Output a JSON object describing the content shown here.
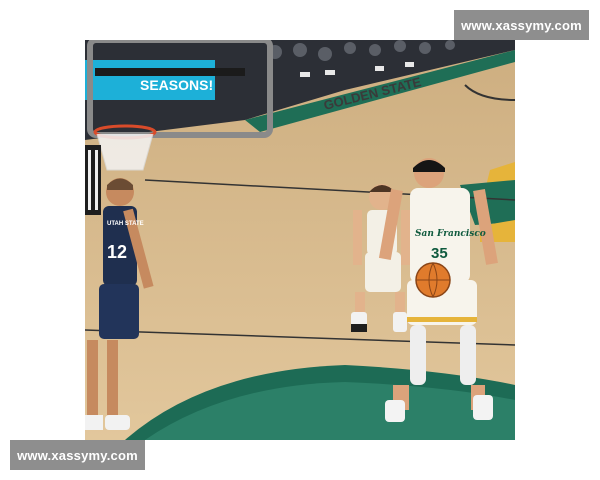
{
  "watermarks": {
    "top_right": "www.xassymy.com",
    "bottom_left": "www.xassymy.com"
  },
  "photo": {
    "banner_text": "SEASONS!",
    "court_text": "GOLDEN STATE",
    "shooter_jersey_team": "San Francisco",
    "shooter_jersey_number": "35",
    "opponent_jersey_team": "UTAH STATE",
    "opponent_jersey_number": "12"
  },
  "colors": {
    "court_wood": "#d9bb8d",
    "court_green": "#1f6e56",
    "court_gold": "#e6b43a",
    "usf_green": "#0f5a3e",
    "opponent_navy": "#1f2f4f"
  }
}
